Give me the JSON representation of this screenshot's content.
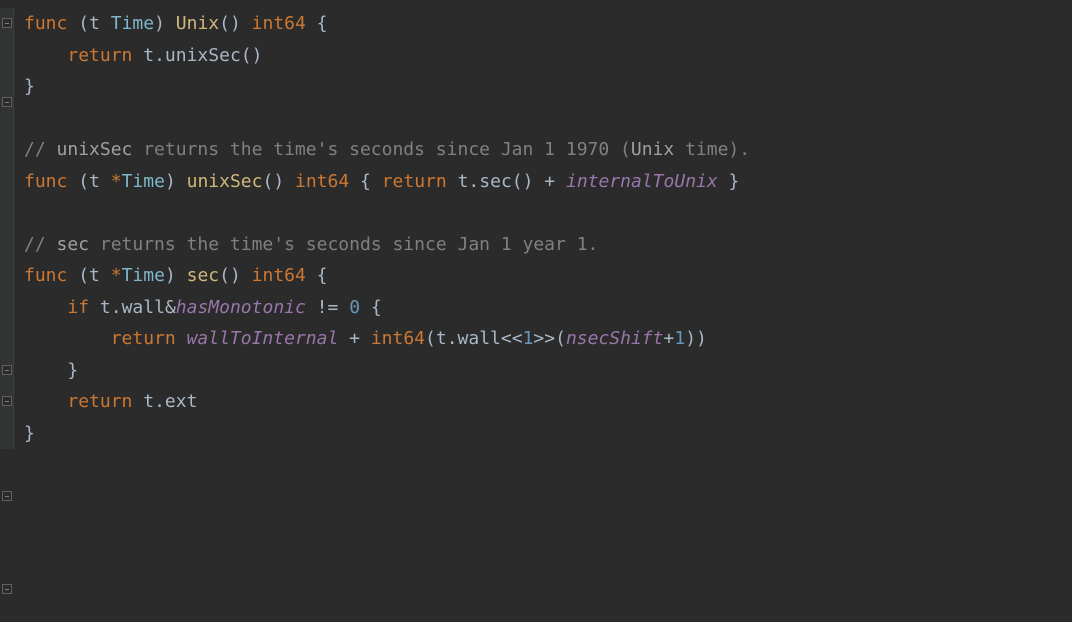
{
  "code": {
    "line1_func": "func",
    "line1_paren_open": " (",
    "line1_t": "t ",
    "line1_Time": "Time",
    "line1_paren_close": ") ",
    "line1_Unix": "Unix",
    "line1_sig_open": "() ",
    "line1_int64": "int64",
    "line1_brace": " {",
    "line2_indent": "    ",
    "line2_return": "return",
    "line2_space": " ",
    "line2_t": "t",
    "line2_dot": ".",
    "line2_unixSec": "unixSec",
    "line2_call": "()",
    "line3_close": "}",
    "line5_comment_start": "// ",
    "line5_unixSec": "unixSec",
    "line5_rest": " returns the time's seconds since Jan 1 1970 (",
    "line5_Unix": "Unix",
    "line5_end": " time).",
    "line6_func": "func",
    "line6_paren_open": " (",
    "line6_t": "t ",
    "line6_star": "*",
    "line6_Time": "Time",
    "line6_paren_close": ") ",
    "line6_unixSec": "unixSec",
    "line6_sig": "() ",
    "line6_int64": "int64",
    "line6_brace_open": " { ",
    "line6_return": "return",
    "line6_space": " ",
    "line6_t2": "t",
    "line6_dot": ".",
    "line6_sec": "sec",
    "line6_call": "()",
    "line6_plus": " + ",
    "line6_const": "internalToUnix",
    "line6_brace_close": " }",
    "line8_comment_start": "// ",
    "line8_sec": "sec",
    "line8_rest": " returns the time's seconds since Jan 1 year 1.",
    "line9_func": "func",
    "line9_paren_open": " (",
    "line9_t": "t ",
    "line9_star": "*",
    "line9_Time": "Time",
    "line9_paren_close": ") ",
    "line9_sec": "sec",
    "line9_sig": "() ",
    "line9_int64": "int64",
    "line9_brace": " {",
    "line10_indent": "    ",
    "line10_if": "if",
    "line10_space": " ",
    "line10_t": "t",
    "line10_dot": ".",
    "line10_wall": "wall",
    "line10_amp": "&",
    "line10_hasMono": "hasMonotonic",
    "line10_neq": " != ",
    "line10_zero": "0",
    "line10_brace": " {",
    "line11_indent": "        ",
    "line11_return": "return",
    "line11_space": " ",
    "line11_wallToInternal": "wallToInternal",
    "line11_plus": " + ",
    "line11_int64": "int64",
    "line11_paren_open": "(",
    "line11_t": "t",
    "line11_dot": ".",
    "line11_wall": "wall",
    "line11_lshift": "<<",
    "line11_one": "1",
    "line11_rshift": ">>",
    "line11_paren2_open": "(",
    "line11_nsecShift": "nsecShift",
    "line11_plus2": "+",
    "line11_one2": "1",
    "line11_paren2_close": ")",
    "line11_paren_close": ")",
    "line12_indent": "    ",
    "line12_close": "}",
    "line13_indent": "    ",
    "line13_return": "return",
    "line13_space": " ",
    "line13_t": "t",
    "line13_dot": ".",
    "line13_ext": "ext",
    "line14_close": "}"
  }
}
